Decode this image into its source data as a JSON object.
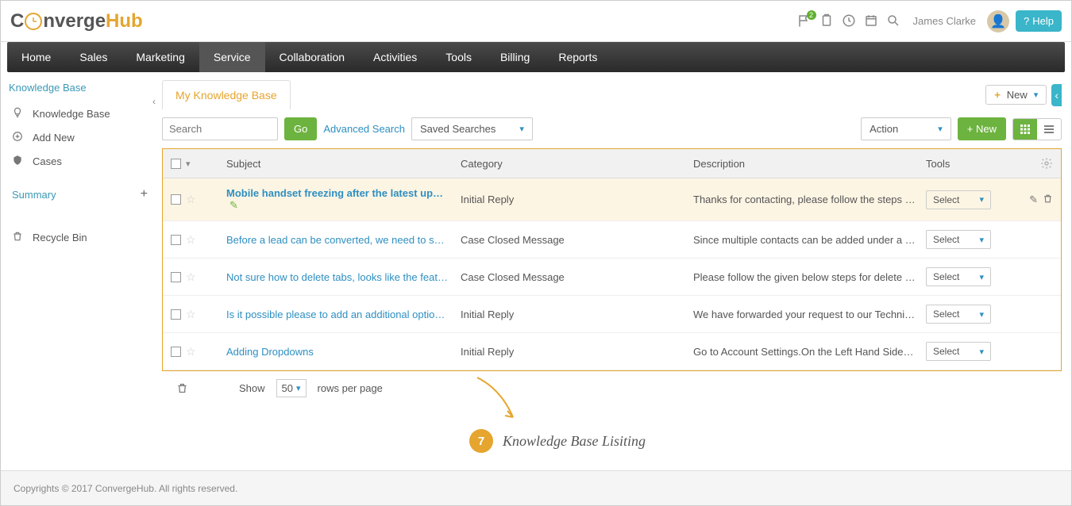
{
  "header": {
    "logo_c": "C",
    "logo_onverge": "nverge",
    "logo_hub": "Hub",
    "username": "James Clarke",
    "help": "Help",
    "notif_count": "2"
  },
  "nav": [
    "Home",
    "Sales",
    "Marketing",
    "Service",
    "Collaboration",
    "Activities",
    "Tools",
    "Billing",
    "Reports"
  ],
  "nav_active": 3,
  "sidebar": {
    "title": "Knowledge Base",
    "items": [
      "Knowledge Base",
      "Add New",
      "Cases"
    ],
    "summary": "Summary",
    "recycle": "Recycle Bin"
  },
  "tab": "My Knowledge Base",
  "new_dd": "New",
  "search_placeholder": "Search",
  "go": "Go",
  "advanced": "Advanced Search",
  "saved": "Saved Searches",
  "action": "Action",
  "new_btn": "+ New",
  "columns": {
    "subject": "Subject",
    "category": "Category",
    "description": "Description",
    "tools": "Tools"
  },
  "rows": [
    {
      "subject": "Mobile handset freezing after the latest update",
      "category": "Initial Reply",
      "description": "Thanks for contacting, please follow the steps belo...",
      "select": "Select",
      "hovered": true
    },
    {
      "subject": "Before a lead can be converted, we need to send...",
      "category": "Case Closed Message",
      "description": "Since multiple contacts can be added under a Lea...",
      "select": "Select",
      "hovered": false
    },
    {
      "subject": "Not sure how to delete tabs, looks like the featur...",
      "category": "Case Closed Message",
      "description": "Please follow the given below steps for delete the t...",
      "select": "Select",
      "hovered": false
    },
    {
      "subject": "Is it possible please to add an additional option in...",
      "category": "Initial Reply",
      "description": "We have forwarded your request to our Technical T...",
      "select": "Select",
      "hovered": false
    },
    {
      "subject": "Adding Dropdowns",
      "category": "Initial Reply",
      "description": "Go to Account Settings.On the Left Hand Side Pan...",
      "select": "Select",
      "hovered": false
    }
  ],
  "show": "Show",
  "rows_per": "50",
  "rows_label": "rows per page",
  "annotation": {
    "num": "7",
    "text": "Knowledge Base Lisiting"
  },
  "footer": "Copyrights © 2017 ConvergeHub. All rights reserved."
}
